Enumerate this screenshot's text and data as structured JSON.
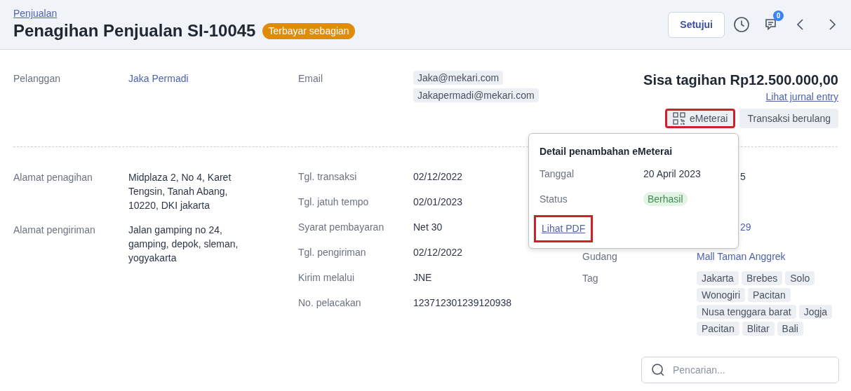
{
  "breadcrumb": "Penjualan",
  "title": "Penagihan Penjualan SI-10045",
  "status_badge": "Terbayar sebagian",
  "header_actions": {
    "approve_button": "Setujui",
    "comments_count": "0"
  },
  "customer": {
    "label": "Pelanggan",
    "value": "Jaka Permadi"
  },
  "email": {
    "label": "Email",
    "values": [
      "Jaka@mekari.com",
      "Jakapermadi@mekari.com"
    ]
  },
  "balance": "Sisa tagihan Rp12.500.000,00",
  "journal_link": "Lihat jurnal entry",
  "action_chips": [
    {
      "kind": "emeterai",
      "label": "eMeterai",
      "highlighted": true
    },
    {
      "kind": "plain",
      "label": "Transaksi berulang",
      "highlighted": false
    }
  ],
  "addresses": [
    {
      "label": "Alamat penagihan",
      "value": "Midplaza 2, No 4, Karet Tengsin, Tanah Abang, 10220, DKI jakarta"
    },
    {
      "label": "Alamat pengiriman",
      "value": "Jalan gamping no 24, gamping, depok, sleman, yogyakarta"
    }
  ],
  "details": [
    {
      "label": "Tgl. transaksi",
      "value": "02/12/2022"
    },
    {
      "label": "Tgl. jatuh tempo",
      "value": "02/01/2023"
    },
    {
      "label": "Syarat pembayaran",
      "value": "Net 30"
    },
    {
      "label": "Tgl. pengiriman",
      "value": "02/12/2022"
    },
    {
      "label": "Kirim melalui",
      "value": "JNE"
    },
    {
      "label": "No. pelacakan",
      "value": "123712301239120938"
    }
  ],
  "details_right": [
    {
      "kind": "fragment",
      "value": "5"
    },
    {
      "kind": "empty"
    },
    {
      "kind": "link_fragment",
      "value": "29"
    },
    {
      "kind": "row",
      "label": "Gudang",
      "value": "Mall Taman Anggrek"
    },
    {
      "kind": "tags",
      "label": "Tag",
      "tags": [
        "Jakarta",
        "Brebes",
        "Solo",
        "Wonogiri",
        "Pacitan",
        "Nusa tenggara barat",
        "Jogja",
        "Pacitan",
        "Blitar",
        "Bali"
      ]
    }
  ],
  "popover": {
    "title": "Detail penambahan eMeterai",
    "rows": [
      {
        "kind": "text",
        "label": "Tanggal",
        "value": "20 April 2023"
      },
      {
        "kind": "status",
        "label": "Status",
        "value": "Berhasil"
      }
    ],
    "pdf_link": "Lihat PDF",
    "pdf_highlighted": true
  },
  "search": {
    "placeholder": "Pencarian..."
  }
}
